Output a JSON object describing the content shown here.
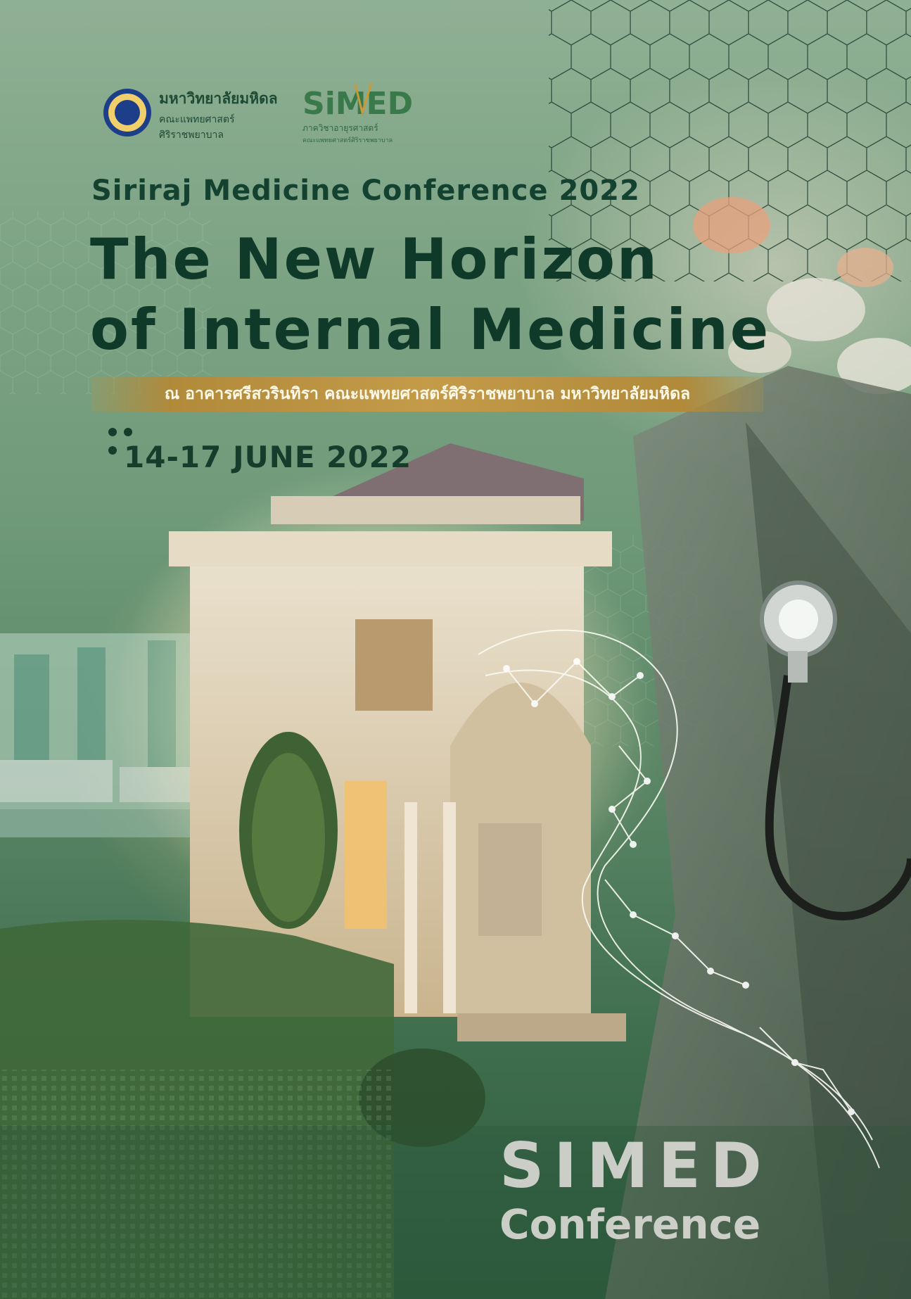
{
  "university": {
    "name_th": "มหาวิทยาลัยมหิดล",
    "faculty_line1": "คณะแพทยศาสตร์",
    "faculty_line2": "ศิริราชพยาบาล"
  },
  "simed_logo": {
    "wordmark": "SiMED",
    "dept_th": "ภาควิชาอายุรศาสตร์",
    "sub_th": "คณะแพทยศาสตร์ศิริราชพยาบาล"
  },
  "conference": {
    "name": "Siriraj Medicine Conference 2022",
    "theme_line1": "The New Horizon",
    "theme_line2": "of Internal Medicine",
    "venue": "ณ อาคารศรีสวรินทิรา คณะแพทยศาสตร์ศิริราชพยาบาล มหาวิทยาลัยมหิดล",
    "dates": "14-17 JUNE 2022"
  },
  "brand": {
    "line1": "SIMED",
    "line2": "Conference"
  },
  "imagery": {
    "icons": [
      "university-seal-icon",
      "simed-logo-icon",
      "stethoscope-icon",
      "dna-helix-icon",
      "hexagon-network-icon"
    ],
    "colors": {
      "primary_green": "#0f3a2a",
      "gold_bar": "#c39b49",
      "brand_grey": "#d8d8d2"
    }
  }
}
